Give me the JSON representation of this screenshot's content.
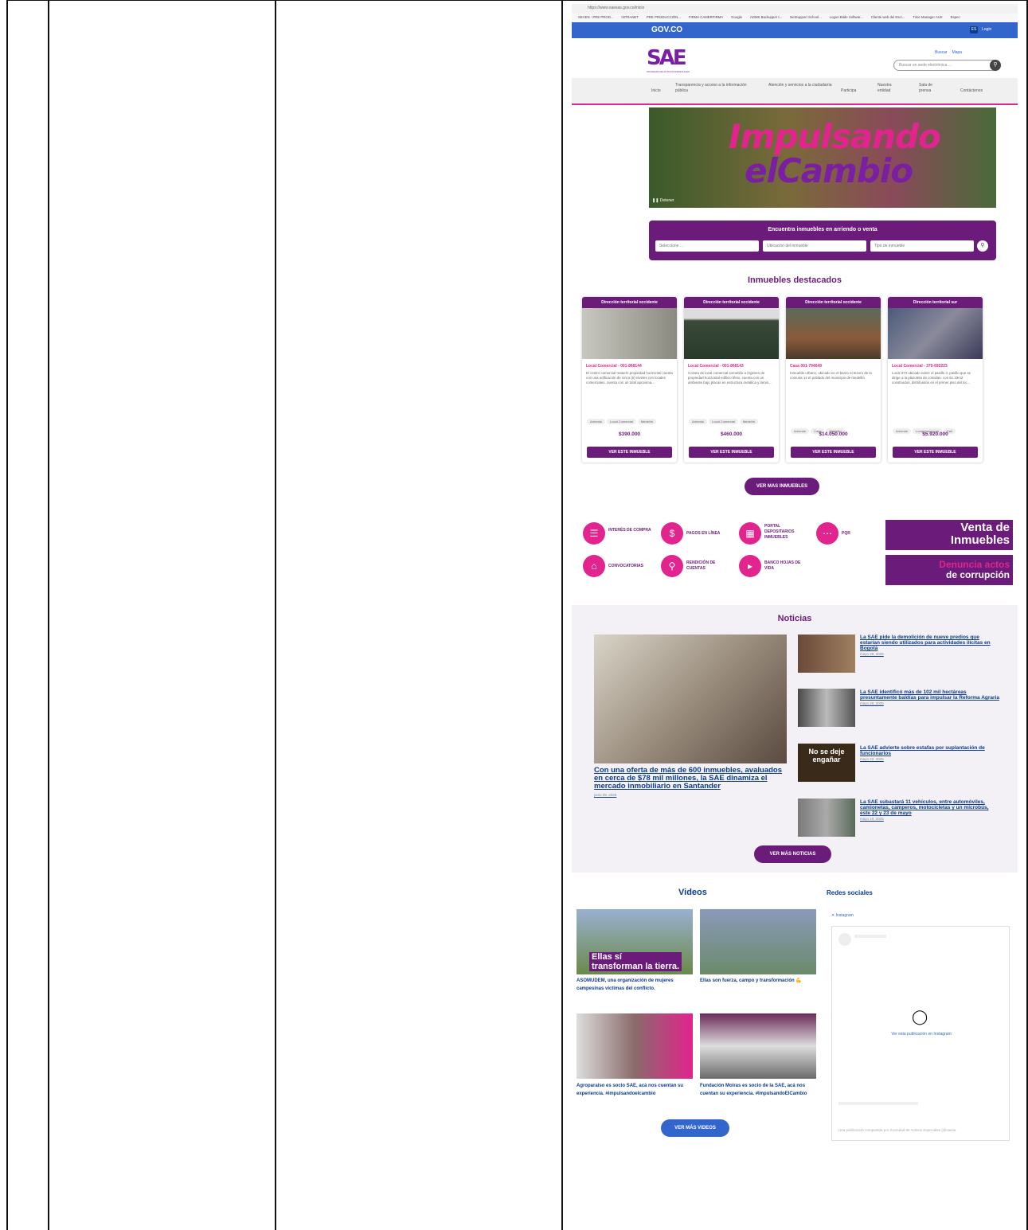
{
  "browser": {
    "url": "https://www.saesas.gov.co/inicio",
    "bookmarks": [
      "SEVEN - PRE PROD...",
      "INTRANET",
      "PRE PRODUCCIÓN...",
      "FIRMA CAMERFIRMA",
      "Google",
      "ADMS Backupper t...",
      "NetSupport School...",
      "Logon Bitde Softwar...",
      "Cliente web del Escr...",
      "Time Manager AUX",
      "Espec"
    ]
  },
  "gov": {
    "label": "GOV.CO",
    "lang": "ES",
    "login": "Login"
  },
  "header": {
    "logo_text": "SAE",
    "logo_sub": "SOCIEDAD DE ACTIVOS ESPECIALES",
    "links": [
      "Buscar",
      "Mapa"
    ],
    "search_placeholder": "Buscar en sede electrónica ..."
  },
  "nav": [
    "Inicio",
    "Transparencia y acceso a la información pública",
    "Atención y servicios a la ciudadanía",
    "Participa",
    "Nuestra entidad",
    "Sala de prensa",
    "Contáctenos"
  ],
  "banner": {
    "line1": "Impulsando",
    "line2": "elCambio",
    "pause": "Detener"
  },
  "finder": {
    "title": "Encuentra inmuebles en arriendo o venta",
    "selects": [
      "Seleccione ...",
      "Ubicación del inmueble",
      "Tipo de inmueble"
    ]
  },
  "featured": {
    "title": "Inmuebles destacados",
    "button": "VER ESTE INMUEBLE",
    "more": "VER MAS INMUEBLES",
    "cards": [
      {
        "region": "Dirección territorial occidente",
        "title": "Local Comercial - 001-868144",
        "desc": "El centro comercial maturín propiedad horizontal cuenta con una edificación de cinco (5) niveles con locales comerciales. cuenta con un total aproxima...",
        "tags": [
          "Arriendo",
          "Local Comercial",
          "Medellín"
        ],
        "price": "$390.000"
      },
      {
        "region": "Dirección territorial occidente",
        "title": "Local Comercial - 001-868143",
        "desc": "Consta de local comercial sometido a régimen de propiedad horizontal edificio fénix, cuenta con un ambiente bajo placas en estructura metálica y lamin...",
        "tags": [
          "Arriendo",
          "Local Comercial",
          "Medellín"
        ],
        "price": "$460.000"
      },
      {
        "region": "Dirección territorial occidente",
        "title": "Casa 001-794649",
        "desc": "Inmueble urbano, ubicado en el barrio el tesoro de la comuna 14 el poblado del municipio de medellín",
        "tags": [
          "Arriendo",
          "Casa",
          "Medellín"
        ],
        "price": "$14.050.000"
      },
      {
        "region": "Dirección territorial sur",
        "title": "Local Comercial - 370-692223",
        "desc": "Local 373 ubicado sobre el pasillo 3, pasillo que se dirige a la plazoleta de comidas, con 61.33m2 construidos, distribuidos en el primer piso del loc...",
        "tags": [
          "Arriendo",
          "Local Comercial",
          "Cali"
        ],
        "price": "$5.920.000"
      }
    ]
  },
  "services": [
    {
      "label": "INTERÉS DE COMPRA",
      "icon": "list-icon"
    },
    {
      "label": "PAGOS EN LÍNEA",
      "icon": "dollar-icon"
    },
    {
      "label": "PORTAL DEPOSITARIOS INMUEBLES",
      "icon": "building-icon"
    },
    {
      "label": "PQR",
      "icon": "chat-icon"
    },
    {
      "label": "CONVOCATORIAS",
      "icon": "house-icon"
    },
    {
      "label": "RENDICIÓN DE CUENTAS",
      "icon": "magnifier-icon"
    },
    {
      "label": "BANCO HOJAS DE VIDA",
      "icon": "megaphone-icon"
    }
  ],
  "promos": [
    {
      "l1": "Venta de",
      "l2": "Inmuebles"
    },
    {
      "l1": "Denuncia actos",
      "l2": "de corrupción"
    }
  ],
  "news": {
    "title": "Noticias",
    "main": {
      "title": "Con una oferta de más de 600 inmuebles, avaluados en cerca de $78 mil millones, la SAE dinamiza el mercado inmobiliario en Santander",
      "date": "junio 09, 2025"
    },
    "items": [
      {
        "title": "La SAE pide la demolición de nueve predios que estarían siendo utilizados para actividades ilícitas en Bogotá",
        "date": "mayo 28, 2025"
      },
      {
        "title": "La SAE identificó más de 102 mil hectáreas presuntamente baldías para impulsar la Reforma Agraria",
        "date": "mayo 26, 2025"
      },
      {
        "title": "La SAE advierte sobre estafas por suplantación de funcionarios",
        "date": "mayo 22, 2025",
        "img_text": "No se deje engañar"
      },
      {
        "title": "La SAE subastará 11 vehículos, entre automóviles, camionetas, camperos, motocicletas y un microbús, este 22 y 23 de mayo",
        "date": "mayo 19, 2025"
      }
    ],
    "more": "VER MÁS NOTICIAS"
  },
  "videos": {
    "title": "Videos",
    "more": "VER MÁS VIDEOS",
    "items": [
      {
        "title": "ASOMUDEM, una organización de mujeres campesinas víctimas del conflicto.",
        "overlay1": "Ellas sí",
        "overlay2": "transforman la tierra."
      },
      {
        "title": "Ellas son fuerza, campo y transformación 💪"
      },
      {
        "title": "Agroparaíso es socio SAE, acá nos cuentan su experiencia. #impulsandoelcambio"
      },
      {
        "title": "Fundación Moiras es socio de la SAE, acá nos cuentan su experiencia. #ImpulsandoElCambio"
      }
    ]
  },
  "social": {
    "title": "Redes sociales",
    "tab": "Instagram",
    "link": "Ver esta publicación en Instagram",
    "caption": "Una publicación compartida por Sociedad de Activos Especiales (@saesa"
  },
  "colors": {
    "purple": "#6b1c7a",
    "pink": "#e1248e",
    "gov_blue": "#3366cc",
    "link_blue": "#0b3c8c"
  }
}
